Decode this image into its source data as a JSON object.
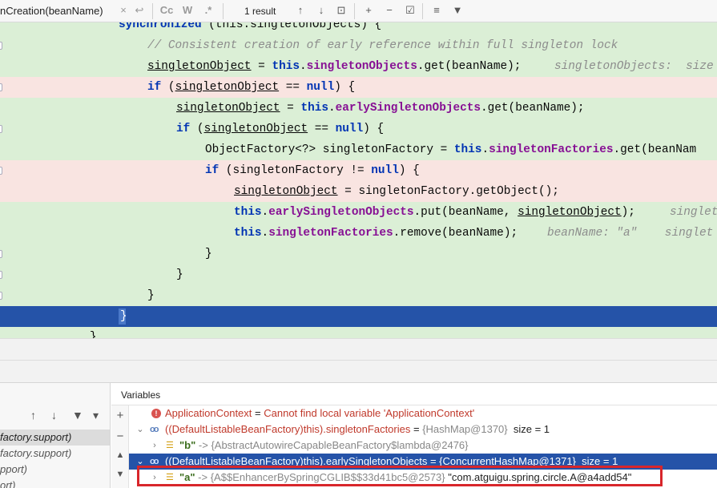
{
  "findbar": {
    "query": "nCreation(beanName)",
    "clear_icon": "×",
    "replace_icon": "↩",
    "match_case": "Cc",
    "words": "W",
    "regex": ".*",
    "result_count": "1 result",
    "prev_icon": "↑",
    "next_icon": "↓",
    "in_selection_icon": "⊡",
    "add_occurrence_icon": "+",
    "remove_occurrence_icon": "−",
    "select_all_icon": "☑",
    "multiline_icon": "≡",
    "filter_icon": "▼"
  },
  "code": {
    "l0_kw": "synchronized",
    "l0_rest": " (this.singletonObjects) {",
    "l1": "// Consistent creation of early reference within full singleton lock",
    "l2_var": "singletonObject",
    "l2_mid": " = ",
    "l2_this": "this",
    "l2_dot": ".",
    "l2_fld": "singletonObjects",
    "l2_rest": ".get(beanName);",
    "l2_hint": "singletonObjects:  size",
    "l3_if": "if",
    "l3_open": " (",
    "l3_var": "singletonObject",
    "l3_eq": " == ",
    "l3_null": "null",
    "l3_close": ") {",
    "l4_var": "singletonObject",
    "l4_mid": " = ",
    "l4_this": "this",
    "l4_dot": ".",
    "l4_fld": "earlySingletonObjects",
    "l4_rest": ".get(beanName);",
    "l5_if": "if",
    "l5_open": " (",
    "l5_var": "singletonObject",
    "l5_eq": " == ",
    "l5_null": "null",
    "l5_close": ") {",
    "l6_type": "ObjectFactory<?> singletonFactory = ",
    "l6_this": "this",
    "l6_dot": ".",
    "l6_fld": "singletonFactories",
    "l6_rest": ".get(beanNam",
    "l7_if": "if",
    "l7_mid": " (singletonFactory != ",
    "l7_null": "null",
    "l7_close": ") {",
    "l8_var": "singletonObject",
    "l8_rest": " = singletonFactory.getObject();",
    "l9_this": "this",
    "l9_dot": ".",
    "l9_fld": "earlySingletonObjects",
    "l9_rest": ".put(beanName, ",
    "l9_var": "singletonObject",
    "l9_end": ");",
    "l9_hint": "singlet",
    "l10_this": "this",
    "l10_dot": ".",
    "l10_fld": "singletonFactories",
    "l10_rest": ".remove(beanName);",
    "l10_hint": "beanName: \"a\"    singlet",
    "l11": "}",
    "l12": "}",
    "l13": "}",
    "l14": "}",
    "l15": "}"
  },
  "frames": {
    "toolbar": {
      "up": "↑",
      "down": "↓",
      "filter": "▼",
      "more": "▾"
    },
    "items": [
      "factory.support)",
      "factory.support)",
      "pport)",
      "ort)"
    ]
  },
  "variables": {
    "header": "Variables",
    "toolbar": {
      "add": "+",
      "remove": "−",
      "up": "▲",
      "down": "▼"
    },
    "rows": [
      {
        "name": "ApplicationContext",
        "eq": " = ",
        "value": "Cannot find local variable 'ApplicationContext'"
      },
      {
        "name": "((DefaultListableBeanFactory)this).singletonFactories",
        "eq": " = ",
        "value": "{HashMap@1370}",
        "extra": "size = 1"
      },
      {
        "name": "\"b\"",
        "arrow": " -> ",
        "value": "{AbstractAutowireCapableBeanFactory$lambda@2476}"
      },
      {
        "name": "((DefaultListableBeanFactory)this).earlySingletonObjects",
        "eq": " = ",
        "value": "{ConcurrentHashMap@1371}",
        "extra": "size = 1"
      },
      {
        "name": "\"a\"",
        "arrow": " -> ",
        "value": "{A$$EnhancerBySpringCGLIB$$33d41bc5@2573}",
        "str": "\"com.atguigu.spring.circle.A@a4add54\""
      }
    ]
  },
  "colors": {
    "changed_line": "#dbefd6",
    "breakpoint_line": "#f9e4e1",
    "execution_line": "#2553a8",
    "highlight_box": "#d8262b"
  }
}
